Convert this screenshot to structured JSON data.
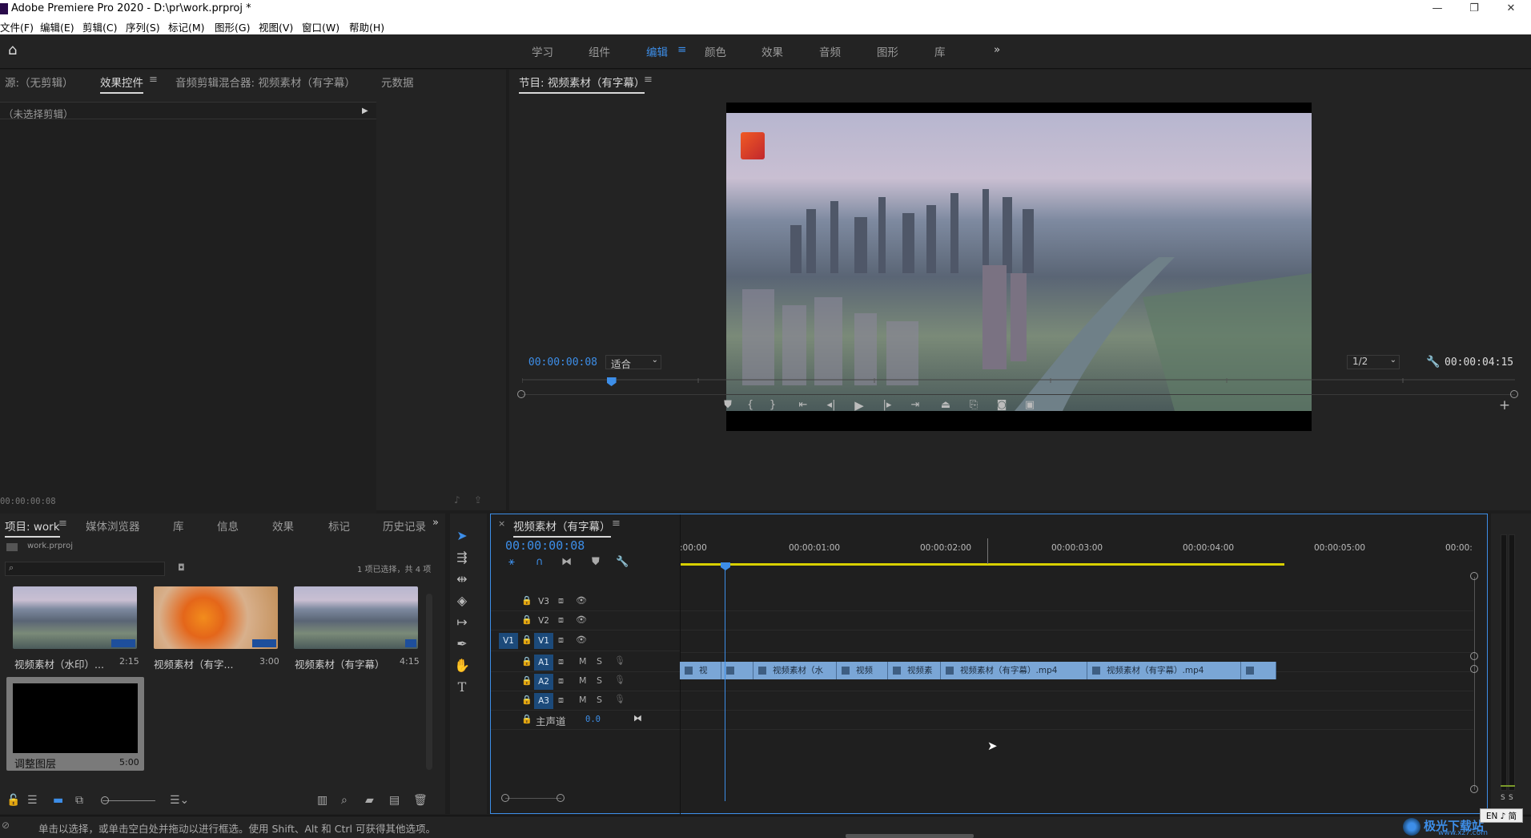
{
  "window": {
    "title": "Adobe Premiere Pro 2020 - D:\\pr\\work.prproj *",
    "controls": [
      "—",
      "❐",
      "✕"
    ]
  },
  "menu": [
    "文件(F)",
    "编辑(E)",
    "剪辑(C)",
    "序列(S)",
    "标记(M)",
    "图形(G)",
    "视图(V)",
    "窗口(W)",
    "帮助(H)"
  ],
  "workspaces": {
    "items": [
      "学习",
      "组件",
      "编辑",
      "颜色",
      "效果",
      "音频",
      "图形",
      "库"
    ],
    "active": "编辑",
    "more": "»"
  },
  "source_panel": {
    "tabs": [
      "源:（无剪辑）",
      "效果控件",
      "音频剪辑混合器: 视频素材（有字幕）",
      "元数据"
    ],
    "active_tab": "效果控件",
    "no_clip_text": "（未选择剪辑）",
    "timecode": "00:00:00:08"
  },
  "program_monitor": {
    "title": "节目: 视频素材（有字幕）",
    "timecode": "00:00:00:08",
    "fit": "适合",
    "resolution": "1/2",
    "duration": "00:00:04:15",
    "playhead_fraction": 0.09
  },
  "project_panel": {
    "tabs": [
      "项目: work",
      "媒体浏览器",
      "库",
      "信息",
      "效果",
      "标记",
      "历史记录"
    ],
    "active_tab": "项目: work",
    "project_file": "work.prproj",
    "search_placeholder": "",
    "selection_status": "1 项已选择，共 4 项",
    "items": [
      {
        "name": "视频素材（水印）...",
        "duration": "2:15"
      },
      {
        "name": "视频素材（有字...",
        "duration": "3:00"
      },
      {
        "name": "视频素材（有字幕）",
        "duration": "4:15"
      },
      {
        "name": "调整图层",
        "duration": "5:00"
      }
    ]
  },
  "timeline": {
    "title": "视频素材（有字幕）",
    "timecode": "00:00:00:08",
    "ruler": [
      ":00:00",
      "00:00:01:00",
      "00:00:02:00",
      "00:00:03:00",
      "00:00:04:00",
      "00:00:05:00",
      "00:00:"
    ],
    "video_tracks": [
      "V3",
      "V2",
      "V1"
    ],
    "audio_tracks": [
      "A1",
      "A2",
      "A3"
    ],
    "source_patch": "V1",
    "mute": "M",
    "solo": "S",
    "master": {
      "label": "主声道",
      "value": "0.0"
    },
    "clips": [
      {
        "label": "视"
      },
      {
        "label": ""
      },
      {
        "label": "视频素材（水"
      },
      {
        "label": "视频"
      },
      {
        "label": "视频素"
      },
      {
        "label": "视频素材（有字幕）.mp4"
      },
      {
        "label": "视频素材（有字幕）.mp4"
      },
      {
        "label": ""
      }
    ]
  },
  "audio_meter": {
    "labels": [
      "S",
      "S"
    ]
  },
  "status_bar": {
    "text": "单击以选择，或单击空白处并拖动以进行框选。使用 Shift、Alt 和 Ctrl 可获得其他选项。"
  },
  "watermark": {
    "text": "极光下载站",
    "url": "www.xz7.com"
  },
  "ime": "EN ♪ 简",
  "colors": {
    "accent": "#3d8ee8",
    "clip": "#7aa6d6",
    "workarea": "#d8d000"
  }
}
